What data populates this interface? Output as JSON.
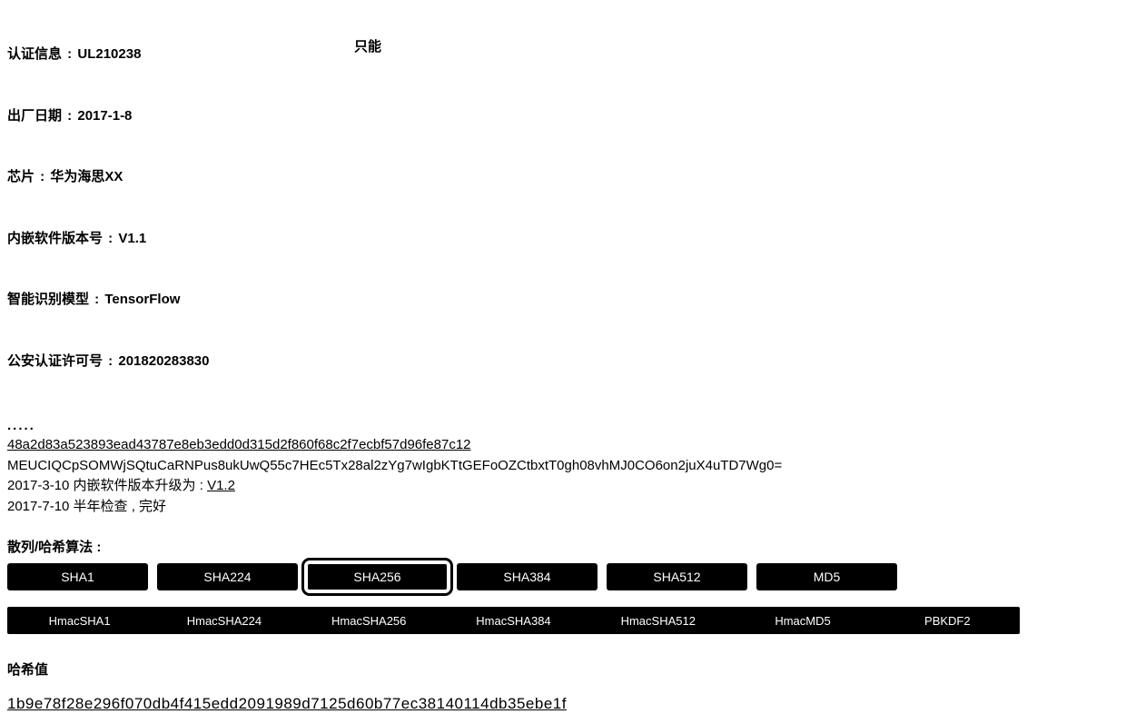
{
  "info": {
    "items": [
      {
        "label": "认证信息",
        "value": "UL210238"
      },
      {
        "label": "出厂日期",
        "value": "2017-1-8"
      },
      {
        "label": "芯片",
        "value": "华为海思XX"
      },
      {
        "label": "内嵌软件版本号",
        "value": "V1.1"
      },
      {
        "label": "智能识别模型",
        "value": "TensorFlow"
      },
      {
        "label": "公安认证许可号",
        "value": "201820283830"
      }
    ],
    "side_note": "只能"
  },
  "log": {
    "dots": ".....",
    "hash_line": "48a2d83a523893ead43787e8eb3edd0d315d2f860f68c2f7ecbf57d96fe87c12",
    "sig_line": "MEUCIQCpSOMWjSQtuCaRNPus8ukUwQ55c7HEc5Tx28al2zYg7wIgbKTtGEFoOZCtbxtT0gh08vhMJ0CO6on2juX4uTD7Wg0=",
    "entry1_prefix": "2017-3-10 内嵌软件版本升级为 : ",
    "entry1_value": "V1.2",
    "entry2": "2017-7-10 半年检查 , 完好"
  },
  "hash_algo": {
    "section_label": "散列/哈希算法 :",
    "row1": [
      "SHA1",
      "SHA224",
      "SHA256",
      "SHA384",
      "SHA512",
      "MD5"
    ],
    "selected_index": 2,
    "row2": [
      "HmacSHA1",
      "HmacSHA224",
      "HmacSHA256",
      "HmacSHA384",
      "HmacSHA512",
      "HmacMD5",
      "PBKDF2"
    ]
  },
  "hash_result": {
    "label": "哈希值",
    "value": "1b9e78f28e296f070db4f415edd2091989d7125d60b77ec38140114db35ebe1f"
  }
}
